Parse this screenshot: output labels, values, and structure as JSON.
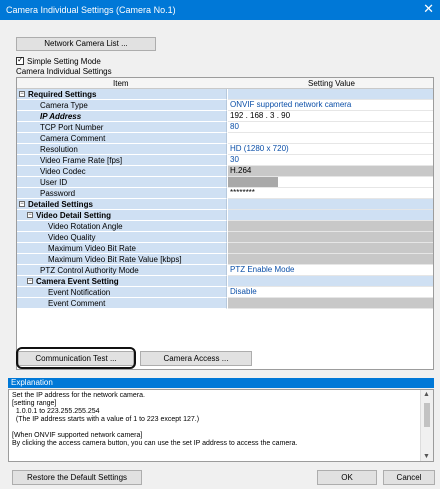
{
  "window": {
    "title": "Camera Individual Settings (Camera No.1)"
  },
  "toolbar": {
    "network_camera_list": "Network Camera List ..."
  },
  "simple_setting_mode": {
    "label": "Simple Setting Mode",
    "checked": true
  },
  "group_label": "Camera Individual Settings",
  "grid": {
    "headers": [
      "Item",
      "Setting Value"
    ],
    "rows": [
      {
        "label": "Required Settings",
        "value": "",
        "level": 0,
        "section": true,
        "style": "bold"
      },
      {
        "label": "Camera Type",
        "value": "ONVIF supported network camera",
        "level": 1,
        "value_style": "blue"
      },
      {
        "label": "IP Address",
        "value": "192 . 168 .  3  . 90",
        "level": 1,
        "style": "ital"
      },
      {
        "label": "TCP Port Number",
        "value": "80",
        "level": 1,
        "value_style": "blue"
      },
      {
        "label": "Camera Comment",
        "value": "",
        "level": 1
      },
      {
        "label": "Resolution",
        "value": "HD (1280 x 720)",
        "level": 1,
        "value_style": "blue"
      },
      {
        "label": "Video Frame Rate [fps]",
        "value": "30",
        "level": 1,
        "value_style": "blue"
      },
      {
        "label": "Video Codec",
        "value": "H.264",
        "level": 1,
        "value_style": "gray"
      },
      {
        "label": "User ID",
        "value": "",
        "level": 1,
        "value_style": "greybox"
      },
      {
        "label": "Password",
        "value": "********",
        "level": 1
      },
      {
        "label": "Detailed Settings",
        "value": "",
        "level": 0,
        "section": true,
        "style": "bold"
      },
      {
        "label": "Video Detail Setting",
        "value": "",
        "level": 1,
        "section": true,
        "style": "bold"
      },
      {
        "label": "Video Rotation Angle",
        "value": "",
        "level": 2,
        "value_style": "gray"
      },
      {
        "label": "Video Quality",
        "value": "",
        "level": 2,
        "value_style": "gray"
      },
      {
        "label": "Maximum Video Bit Rate",
        "value": "",
        "level": 2,
        "value_style": "gray"
      },
      {
        "label": "Maximum Video Bit Rate Value [kbps]",
        "value": "",
        "level": 2,
        "value_style": "gray"
      },
      {
        "label": "PTZ Control Authority Mode",
        "value": "PTZ Enable Mode",
        "level": 1,
        "value_style": "blue"
      },
      {
        "label": "Camera Event Setting",
        "value": "",
        "level": 1,
        "section": true,
        "style": "bold"
      },
      {
        "label": "Event Notification",
        "value": "Disable",
        "level": 2,
        "value_style": "blue"
      },
      {
        "label": "Event Comment",
        "value": "",
        "level": 2,
        "value_style": "gray"
      }
    ]
  },
  "buttons": {
    "communication_test": "Communication Test ...",
    "camera_access": "Camera Access ...",
    "restore_default": "Restore the Default Settings",
    "ok": "OK",
    "cancel": "Cancel"
  },
  "explanation": {
    "header": "Explanation",
    "text": "Set the IP address for the network camera.\n[setting range]\n  1.0.0.1 to 223.255.255.254\n  (The IP address starts with a value of 1 to 223 except 127.)\n\n[When ONVIF supported network camera]\nBy clicking the access camera button, you can use the set IP address to access the camera."
  },
  "icons": {
    "close": "close-icon",
    "expand": "collapse-icon",
    "checkbox": "checkmark-icon"
  },
  "colors": {
    "title_bar": "#0078d7",
    "item_column": "#cfe0f3",
    "value_text": "#0b4fa8"
  }
}
